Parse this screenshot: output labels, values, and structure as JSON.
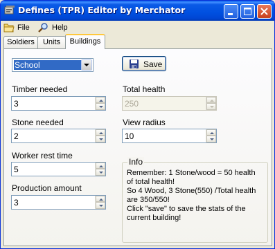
{
  "window": {
    "title": "Defines (TPR) Editor by Merchator"
  },
  "menu": {
    "file": "File",
    "help": "Help"
  },
  "tabs": [
    {
      "label": "Soldiers"
    },
    {
      "label": "Units"
    },
    {
      "label": "Buildings"
    }
  ],
  "building_select": {
    "value": "School"
  },
  "save_button": {
    "label": "Save"
  },
  "fields": {
    "timber": {
      "label": "Timber needed",
      "value": "3"
    },
    "stone": {
      "label": "Stone needed",
      "value": "2"
    },
    "worker_rest": {
      "label": "Worker rest time",
      "value": "5"
    },
    "production": {
      "label": "Production amount",
      "value": "3"
    },
    "total_health": {
      "label": "Total health",
      "value": "250"
    },
    "view_radius": {
      "label": "View radius",
      "value": "10"
    }
  },
  "info": {
    "title": "Info",
    "lines": [
      "Remember: 1 Stone/wood = 50 health",
      "of total health!",
      "So 4 Wood, 3 Stone(550) /Total health",
      "are 350/550!",
      "Click \"save\" to save the stats of the",
      "current building!"
    ]
  },
  "colors": {
    "titlebar": "#0054e3",
    "selection": "#316ac5",
    "active_tab_accent": "#ffc83c"
  }
}
